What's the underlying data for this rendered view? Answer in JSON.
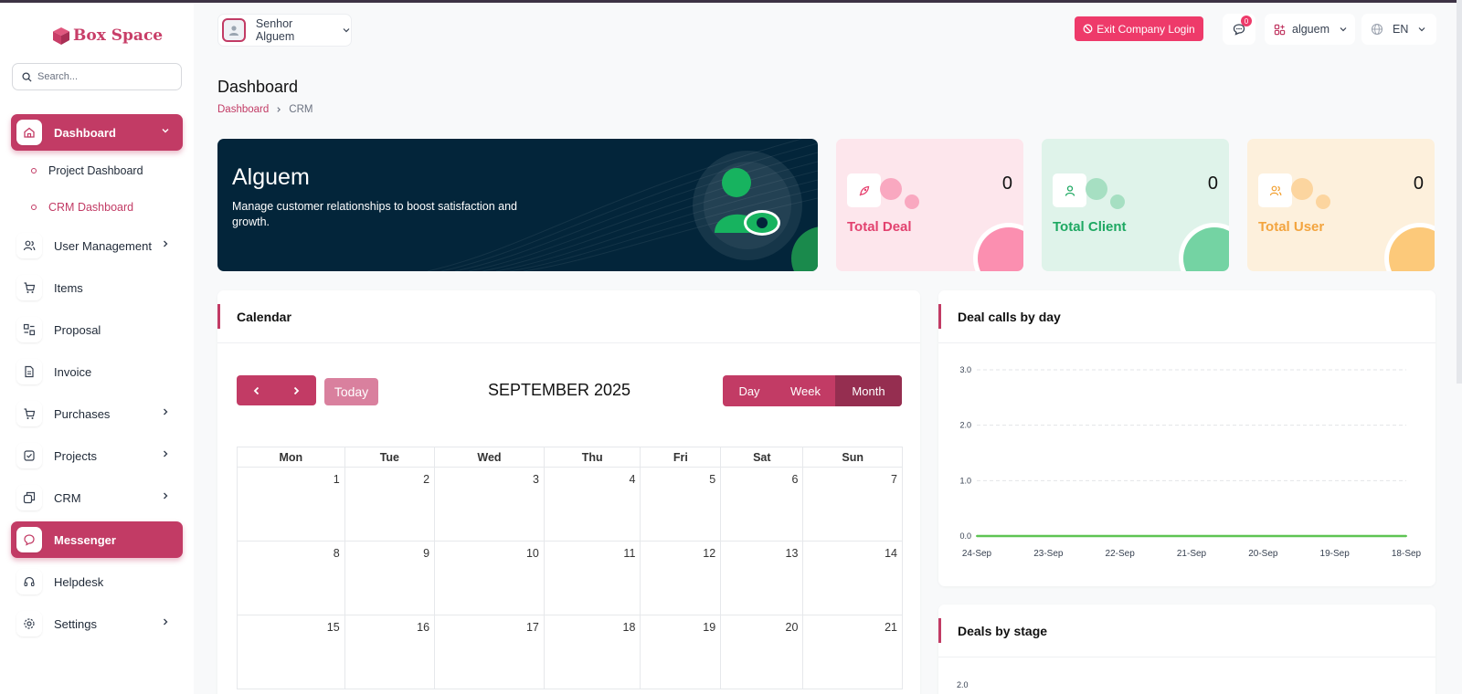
{
  "brand": {
    "name": "Box Space"
  },
  "search": {
    "placeholder": "Search..."
  },
  "sidebar": {
    "dashboard": {
      "label": "Dashboard",
      "sub": [
        "Project Dashboard",
        "CRM Dashboard"
      ]
    },
    "items": [
      {
        "label": "User Management",
        "icon": "users-icon",
        "chevron": true
      },
      {
        "label": "Items",
        "icon": "cart-icon",
        "chevron": false
      },
      {
        "label": "Proposal",
        "icon": "proposal-icon",
        "chevron": false
      },
      {
        "label": "Invoice",
        "icon": "invoice-icon",
        "chevron": false
      },
      {
        "label": "Purchases",
        "icon": "cart-icon",
        "chevron": true
      },
      {
        "label": "Projects",
        "icon": "projects-icon",
        "chevron": true
      },
      {
        "label": "CRM",
        "icon": "crm-icon",
        "chevron": true
      },
      {
        "label": "Messenger",
        "icon": "chat-icon",
        "chevron": false
      },
      {
        "label": "Helpdesk",
        "icon": "headset-icon",
        "chevron": false
      },
      {
        "label": "Settings",
        "icon": "gear-icon",
        "chevron": true
      }
    ]
  },
  "topbar": {
    "user_name": "Senhor Alguem",
    "exit_label": "Exit Company Login",
    "notification_count": "0",
    "workspace": "alguem",
    "language": "EN"
  },
  "page": {
    "title": "Dashboard",
    "breadcrumb": [
      "Dashboard",
      "CRM"
    ]
  },
  "hero": {
    "title": "Alguem",
    "text": "Manage customer relationships to boost satisfaction and growth."
  },
  "stats": [
    {
      "label": "Total Deal",
      "value": "0"
    },
    {
      "label": "Total Client",
      "value": "0"
    },
    {
      "label": "Total User",
      "value": "0"
    }
  ],
  "calendar": {
    "title": "Calendar",
    "today_label": "Today",
    "month_label": "SEPTEMBER 2025",
    "views": [
      "Day",
      "Week",
      "Month"
    ],
    "weekdays": [
      "Mon",
      "Tue",
      "Wed",
      "Thu",
      "Fri",
      "Sat",
      "Sun"
    ],
    "weeks": [
      [
        "1",
        "2",
        "3",
        "4",
        "5",
        "6",
        "7"
      ],
      [
        "8",
        "9",
        "10",
        "11",
        "12",
        "13",
        "14"
      ],
      [
        "15",
        "16",
        "17",
        "18",
        "19",
        "20",
        "21"
      ]
    ]
  },
  "deal_calls": {
    "title": "Deal calls by day"
  },
  "deals_stage": {
    "title": "Deals by stage",
    "first_tick": "2.0"
  },
  "colors": {
    "accent": "#c23b65",
    "exit": "#ee3a6a",
    "line": "#5ec453"
  },
  "chart_data": {
    "type": "line",
    "title": "Deal calls by day",
    "categories": [
      "24-Sep",
      "23-Sep",
      "22-Sep",
      "21-Sep",
      "20-Sep",
      "19-Sep",
      "18-Sep"
    ],
    "series": [
      {
        "values": [
          0,
          0,
          0,
          0,
          0,
          0,
          0
        ]
      }
    ],
    "y_ticks": [
      "0.0",
      "1.0",
      "2.0",
      "3.0"
    ],
    "ylim": [
      0,
      3
    ],
    "grid": true
  }
}
